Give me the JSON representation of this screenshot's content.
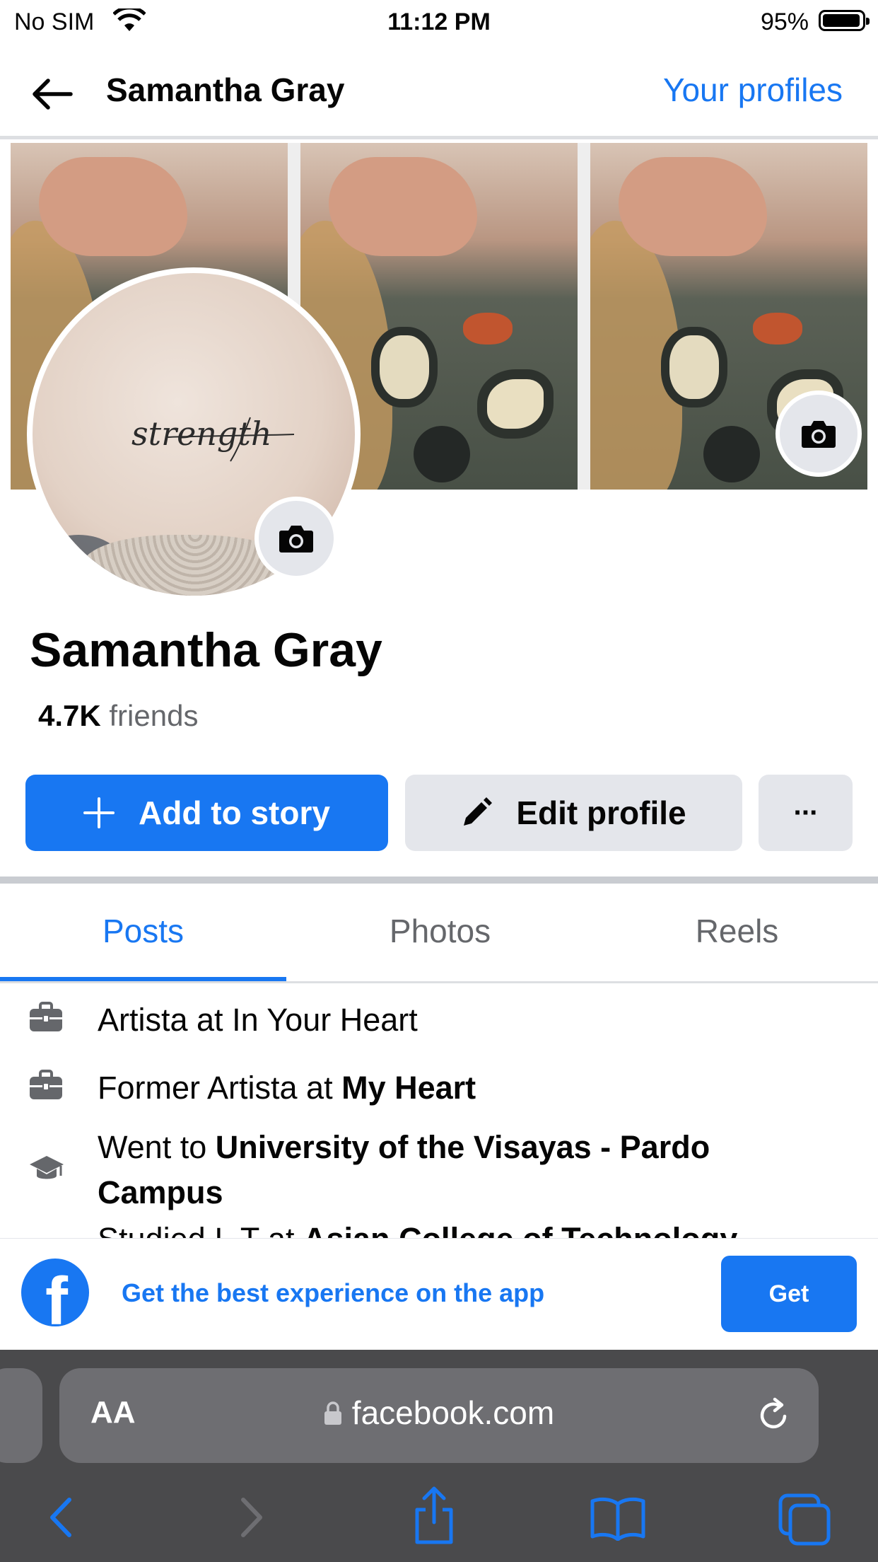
{
  "status_bar": {
    "carrier": "No SIM",
    "time": "11:12 PM",
    "battery": "95%"
  },
  "header": {
    "title": "Samantha Gray",
    "your_profiles": "Your profiles"
  },
  "profile": {
    "name": "Samantha Gray",
    "friends_count": "4.7K",
    "friends_label": "friends",
    "avatar_text": "strength"
  },
  "actions": {
    "add_to_story": "Add to story",
    "edit_profile": "Edit profile",
    "more": "···"
  },
  "tabs": [
    {
      "label": "Posts",
      "active": true
    },
    {
      "label": "Photos",
      "active": false
    },
    {
      "label": "Reels",
      "active": false
    }
  ],
  "intro": [
    {
      "icon": "briefcase-icon",
      "prefix": "Artista at In Your Heart",
      "bold": ""
    },
    {
      "icon": "briefcase-icon",
      "prefix": "Former Artista at ",
      "bold": "My Heart"
    },
    {
      "icon": "graduation-cap-icon",
      "prefix": "Went to ",
      "bold": "University of the Visayas - Pardo Campus"
    },
    {
      "icon": "graduation-cap-icon",
      "prefix": "Studied I. T at ",
      "bold": "Asian College of Technology"
    }
  ],
  "app_banner": {
    "text": "Get the best experience on the app",
    "button": "Get"
  },
  "safari": {
    "aa": "AA",
    "url": "facebook.com"
  },
  "colors": {
    "accent": "#1877f2",
    "secondary_button": "#e4e6eb"
  }
}
